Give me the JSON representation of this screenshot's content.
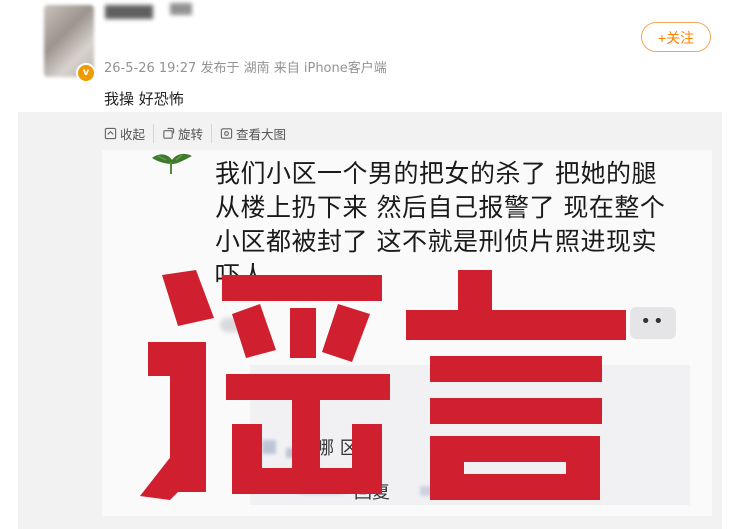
{
  "post": {
    "meta": "26-5-26 19:27 发布于 湖南 来自 iPhone客户端",
    "text": "我操 好恐怖",
    "follow_label": "+关注"
  },
  "actions": [
    {
      "label": "收起",
      "icon": "collapse-icon"
    },
    {
      "label": "旋转",
      "icon": "rotate-icon"
    },
    {
      "label": "查看大图",
      "icon": "image-icon"
    }
  ],
  "card": {
    "lines": [
      "我们小区一个男的把女的杀了 把她的腿",
      "从楼上扔下来 然后自己报警了 现在整个",
      "小区都被封了 这不就是刑侦片照进现实",
      "吓人"
    ],
    "more_label": "••",
    "reply_line1": "哪  区啊",
    "reply_line2": "回复"
  },
  "stamp": {
    "text": "谣言",
    "color": "#d01f2e"
  }
}
